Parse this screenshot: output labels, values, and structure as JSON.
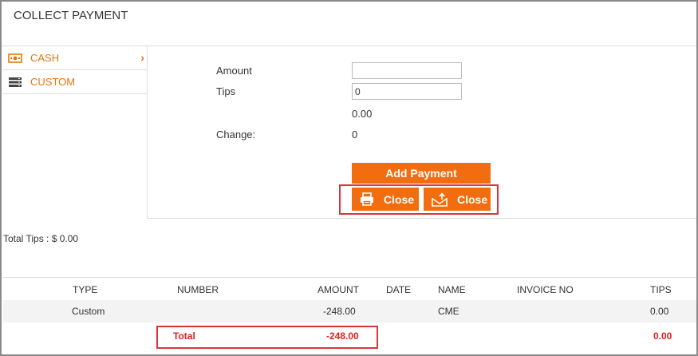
{
  "window": {
    "title": "COLLECT PAYMENT"
  },
  "sidebar": {
    "items": [
      {
        "label": "CASH",
        "icon": "cash-icon",
        "active": true
      },
      {
        "label": "CUSTOM",
        "icon": "server-stack-icon",
        "active": false
      }
    ]
  },
  "form": {
    "amount_label": "Amount",
    "amount_value": "",
    "tips_label": "Tips",
    "tips_value": "0",
    "subtotal_value": "0.00",
    "change_label": "Change:",
    "change_value": "0"
  },
  "buttons": {
    "add_payment": "Add Payment",
    "close_print": "Close",
    "close_send": "Close"
  },
  "summary": {
    "total_tips": "Total Tips : $ 0.00"
  },
  "table": {
    "columns": [
      "TYPE",
      "NUMBER",
      "AMOUNT",
      "DATE",
      "NAME",
      "INVOICE NO",
      "TIPS"
    ],
    "rows": [
      {
        "type": "Custom",
        "number": "",
        "amount": "-248.00",
        "date": "",
        "name": "CME",
        "invoice_no": "",
        "tips": "0.00"
      }
    ],
    "total": {
      "label": "Total",
      "amount": "-248.00",
      "tips": "0.00"
    }
  },
  "colors": {
    "accent": "#f26d0f",
    "highlight_border": "#d9343a",
    "total_text": "#e02020"
  }
}
